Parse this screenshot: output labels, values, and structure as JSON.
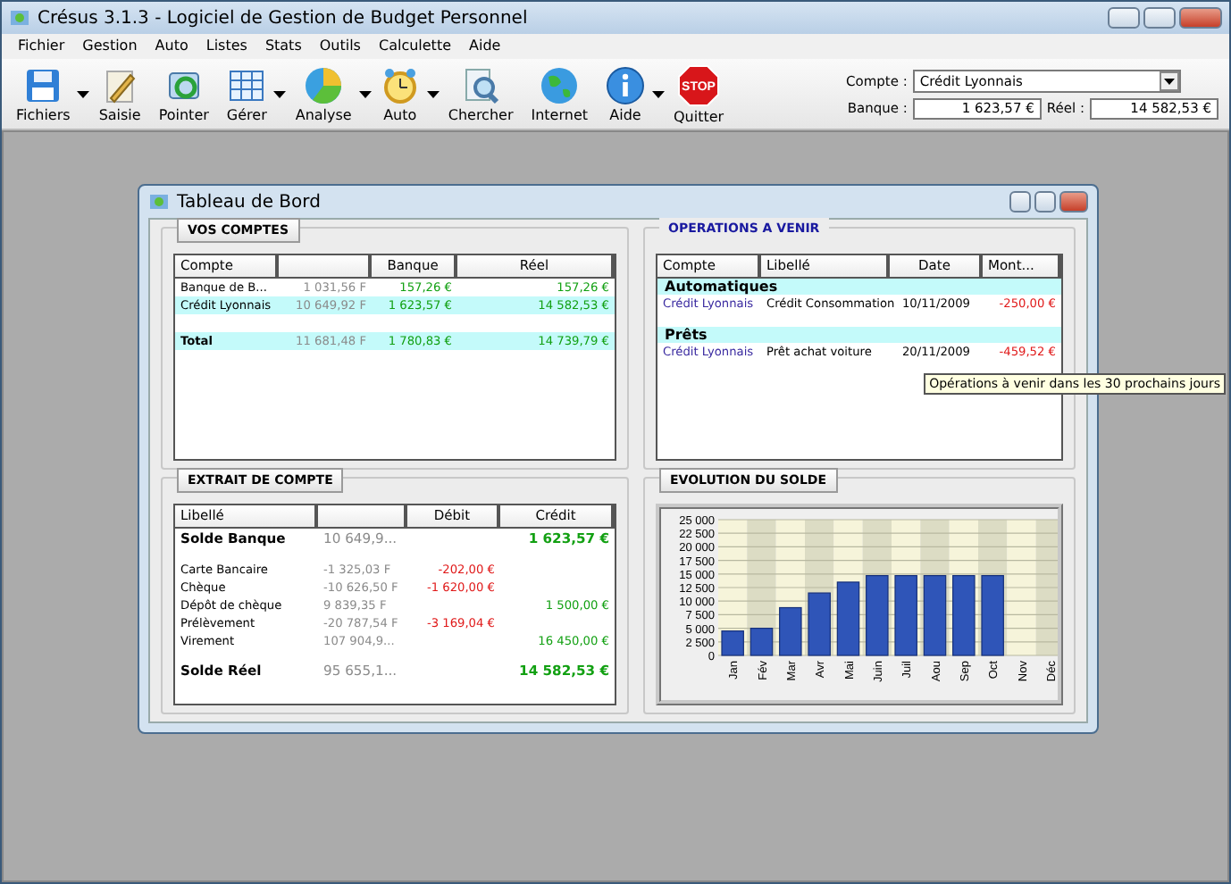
{
  "window": {
    "title": "Crésus 3.1.3 - Logiciel de Gestion de Budget Personnel"
  },
  "menu": [
    "Fichier",
    "Gestion",
    "Auto",
    "Listes",
    "Stats",
    "Outils",
    "Calculette",
    "Aide"
  ],
  "toolbar": [
    {
      "label": "Fichiers",
      "kind": "floppy",
      "has_menu": true
    },
    {
      "label": "Saisie",
      "kind": "pencil",
      "has_menu": false
    },
    {
      "label": "Pointer",
      "kind": "swirl",
      "has_menu": false
    },
    {
      "label": "Gérer",
      "kind": "sheet",
      "has_menu": true
    },
    {
      "label": "Analyse",
      "kind": "pie",
      "has_menu": true
    },
    {
      "label": "Auto",
      "kind": "clock",
      "has_menu": true
    },
    {
      "label": "Chercher",
      "kind": "search",
      "has_menu": false
    },
    {
      "label": "Internet",
      "kind": "globe",
      "has_menu": false
    },
    {
      "label": "Aide",
      "kind": "info",
      "has_menu": true
    },
    {
      "label": "Quitter",
      "kind": "stop",
      "has_menu": false,
      "icon_text": "STOP"
    }
  ],
  "account_box": {
    "compte_label": "Compte :",
    "compte_value": "Crédit Lyonnais",
    "banque_label": "Banque :",
    "banque_value": "1 623,57 €",
    "reel_label": "Réel :",
    "reel_value": "14 582,53 €"
  },
  "dashboard": {
    "title": "Tableau de Bord",
    "vos_comptes": {
      "title": "VOS COMPTES",
      "columns": [
        "Compte",
        "",
        "Banque",
        "Réel"
      ],
      "rows": [
        {
          "kind": "account",
          "highlighted": false,
          "cells": [
            "Banque de B...",
            "1 031,56 F",
            "157,26 €",
            "157,26 €"
          ]
        },
        {
          "kind": "account",
          "highlighted": true,
          "cells": [
            "Crédit Lyonnais",
            "10 649,92 F",
            "1 623,57 €",
            "14 582,53 €"
          ]
        },
        {
          "kind": "total",
          "highlighted": true,
          "cells": [
            "Total",
            "11 681,48 F",
            "1 780,83 €",
            "14 739,79 €"
          ]
        }
      ]
    },
    "operations": {
      "title": "OPERATIONS A VENIR",
      "columns": [
        "Compte",
        "Libellé",
        "Date",
        "Mont..."
      ],
      "groups": [
        {
          "name": "Automatiques",
          "rows": [
            [
              "Crédit Lyonnais",
              "Crédit Consommation",
              "10/11/2009",
              "-250,00 €"
            ]
          ]
        },
        {
          "name": "Prêts",
          "rows": [
            [
              "Crédit Lyonnais",
              "Prêt achat voiture",
              "20/11/2009",
              "-459,52 €"
            ]
          ]
        }
      ],
      "tooltip": "Opérations à venir dans les 30 prochains jours"
    },
    "extrait": {
      "title": "EXTRAIT DE COMPTE",
      "columns": [
        "Libellé",
        "",
        "Débit",
        "Crédit"
      ],
      "rows": [
        {
          "kind": "balance",
          "cells": [
            "Solde Banque",
            "10 649,9...",
            "",
            "1 623,57 €"
          ]
        },
        {
          "kind": "entry",
          "cells": [
            "Carte Bancaire",
            "-1 325,03 F",
            "-202,00 €",
            ""
          ]
        },
        {
          "kind": "entry",
          "cells": [
            "Chèque",
            "-10 626,50 F",
            "-1 620,00 €",
            ""
          ]
        },
        {
          "kind": "entry",
          "cells": [
            "Dépôt de chèque",
            "9 839,35 F",
            "",
            "1 500,00 €"
          ]
        },
        {
          "kind": "entry",
          "cells": [
            "Prélèvement",
            "-20 787,54 F",
            "-3 169,04 €",
            ""
          ]
        },
        {
          "kind": "entry",
          "cells": [
            "Virement",
            "107 904,9...",
            "",
            "16 450,00 €"
          ]
        },
        {
          "kind": "balance",
          "cells": [
            "Solde Réel",
            "95 655,1...",
            "",
            "14 582,53 €"
          ]
        }
      ]
    },
    "evolution": {
      "title": "EVOLUTION DU SOLDE",
      "chart_data": {
        "type": "bar",
        "categories": [
          "Jan",
          "Fév",
          "Mar",
          "Avr",
          "Mai",
          "Juin",
          "Juil",
          "Aou",
          "Sep",
          "Oct",
          "Nov",
          "Déc"
        ],
        "values": [
          4500,
          5000,
          8800,
          11500,
          13500,
          14700,
          14700,
          14700,
          14700,
          14700,
          null,
          null
        ],
        "ylim": [
          0,
          25000
        ],
        "grid": true,
        "yticks": [
          {
            "value": 0,
            "label": "0"
          },
          {
            "value": 2500,
            "label": "2 500"
          },
          {
            "value": 5000,
            "label": "5 000"
          },
          {
            "value": 7500,
            "label": "7 500"
          },
          {
            "value": 10000,
            "label": "10 000"
          },
          {
            "value": 12500,
            "label": "12 500"
          },
          {
            "value": 15000,
            "label": "15 000"
          },
          {
            "value": 17500,
            "label": "17 500"
          },
          {
            "value": 20000,
            "label": "20 000"
          },
          {
            "value": 22500,
            "label": "22 500"
          },
          {
            "value": 25000,
            "label": "25 000"
          }
        ]
      }
    }
  }
}
